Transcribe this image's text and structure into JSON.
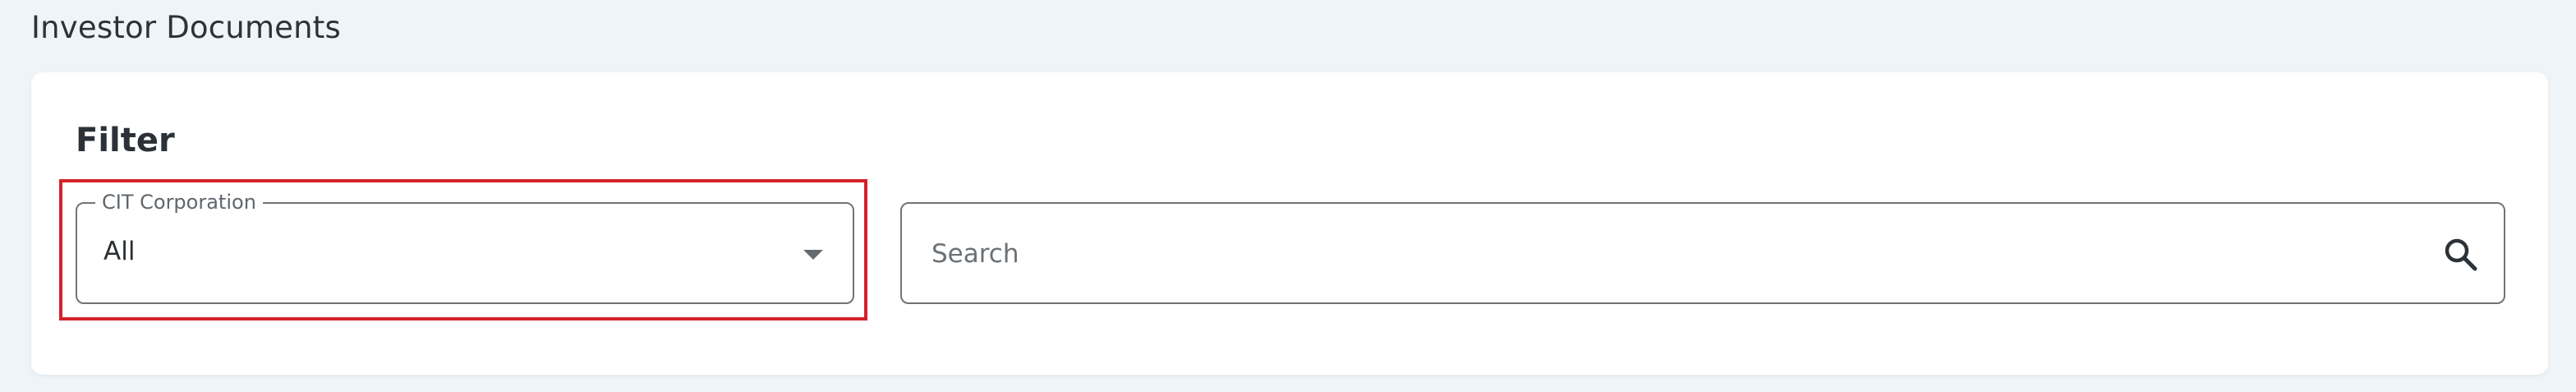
{
  "page": {
    "title": "Investor Documents"
  },
  "filter": {
    "title": "Filter",
    "corporation_select": {
      "label": "CIT Corporation",
      "value": "All",
      "icon": "chevron-down-icon"
    },
    "search": {
      "placeholder": "Search",
      "value": "",
      "icon": "search-icon"
    }
  },
  "colors": {
    "background": "#eef4f7",
    "card": "#ffffff",
    "highlight": "#d3222a",
    "border": "#6f7479"
  }
}
